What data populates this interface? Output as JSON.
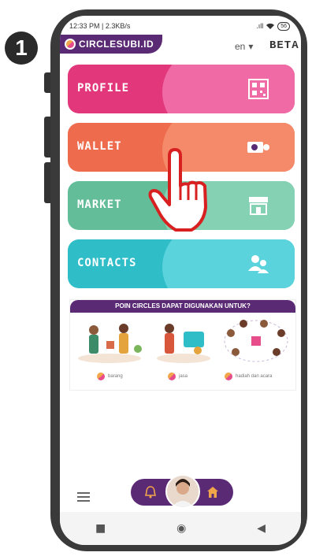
{
  "step_number": "1",
  "status_bar": {
    "time_net": "12:33 PM | 2.3KB/s",
    "signal": ".ıll",
    "wifi": "wifi",
    "battery": "56"
  },
  "brand": {
    "name": "CIRCLESUBI.ID"
  },
  "header": {
    "language": "en",
    "language_arrow": "▾",
    "badge": "BETA"
  },
  "menu": [
    {
      "label": "PROFILE",
      "icon": "qr-code-icon",
      "base": "#e2387b",
      "blob": "#f06aa5"
    },
    {
      "label": "WALLET",
      "icon": "circles-card-icon",
      "base": "#ee6c4d",
      "blob": "#f58a6a"
    },
    {
      "label": "MARKET",
      "icon": "shop-icon",
      "base": "#63bd99",
      "blob": "#84d1b3"
    },
    {
      "label": "CONTACTS",
      "icon": "contacts-icon",
      "base": "#2fbdc8",
      "blob": "#5ad3dd"
    }
  ],
  "banner": {
    "title": "POIN CIRCLES DAPAT DIGUNAKAN UNTUK?",
    "captions": [
      "barang",
      "jasa",
      "hadiah dan acara"
    ]
  },
  "bottom_nav": {
    "menu_icon": "hamburger-icon",
    "left_icon": "bell-icon",
    "right_icon": "home-icon"
  },
  "system_nav": {
    "recent": "■",
    "home": "◉",
    "back": "◀"
  },
  "colors": {
    "brand_purple": "#5b2a74",
    "accent_orange": "#f2a64a"
  }
}
